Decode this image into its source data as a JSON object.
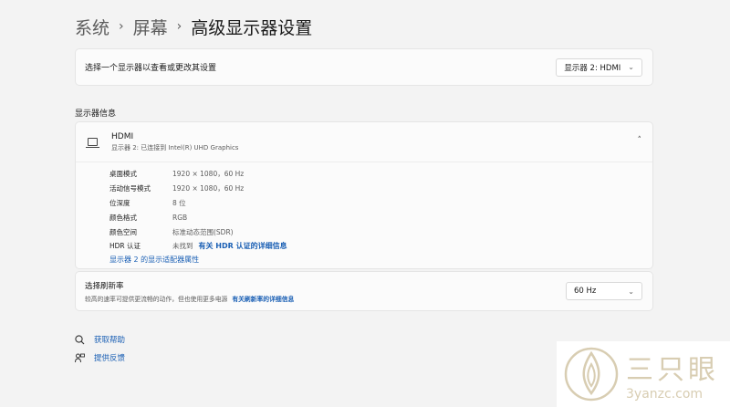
{
  "breadcrumb": {
    "item1": "系统",
    "item2": "屏幕",
    "current": "高级显示器设置",
    "sep": "›"
  },
  "display_select": {
    "label": "选择一个显示器以查看或更改其设置",
    "value": "显示器 2: HDMI"
  },
  "section_title": "显示器信息",
  "display_info": {
    "name": "HDMI",
    "subtitle": "显示器 2: 已连接到 Intel(R) UHD Graphics",
    "rows": [
      {
        "key": "桌面模式",
        "value": "1920 × 1080，60 Hz"
      },
      {
        "key": "活动信号模式",
        "value": "1920 × 1080，60 Hz"
      },
      {
        "key": "位深度",
        "value": "8 位"
      },
      {
        "key": "颜色格式",
        "value": "RGB"
      },
      {
        "key": "颜色空间",
        "value": "标准动态范围(SDR)"
      },
      {
        "key": "HDR 认证",
        "value": "未找到",
        "link": "有关 HDR 认证的详细信息"
      }
    ],
    "adapter_link": "显示器 2 的显示适配器属性"
  },
  "refresh": {
    "title": "选择刷新率",
    "desc": "较高的速率可提供更流畅的动作，但也使用更多电源",
    "link": "有关刷新率的详细信息",
    "value": "60 Hz"
  },
  "help": {
    "get_help": "获取帮助",
    "feedback": "提供反馈"
  },
  "watermark": {
    "cn": "三只眼",
    "url": "3yanzc.com"
  },
  "icons": {
    "chevron_down": "⌄",
    "chevron_up": "˄"
  }
}
